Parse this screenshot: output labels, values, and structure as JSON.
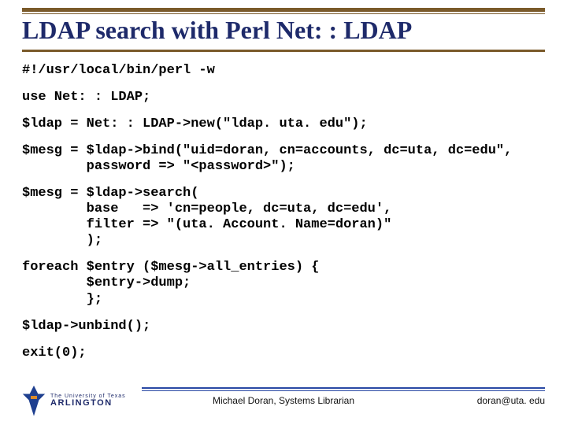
{
  "title": "LDAP search with Perl Net: : LDAP",
  "code": {
    "l1": "#!/usr/local/bin/perl -w",
    "l2": "use Net: : LDAP;",
    "l3": "$ldap = Net: : LDAP->new(\"ldap. uta. edu\");",
    "l4a": "$mesg = $ldap->bind(\"uid=doran, cn=accounts, dc=uta, dc=edu\",",
    "l4b": "        password => \"<password>\");",
    "l5a": "$mesg = $ldap->search(",
    "l5b": "        base   => 'cn=people, dc=uta, dc=edu',",
    "l5c": "        filter => \"(uta. Account. Name=doran)\"",
    "l5d": "        );",
    "l6a": "foreach $entry ($mesg->all_entries) {",
    "l6b": "        $entry->dump;",
    "l6c": "        };",
    "l7": "$ldap->unbind();",
    "l8": "exit(0);"
  },
  "footer": {
    "logo_top": "The University of Texas",
    "logo_main": "ARLINGTON",
    "center": "Michael Doran, Systems Librarian",
    "right": "doran@uta. edu"
  },
  "colors": {
    "title": "#1e2a6a",
    "rule": "#7a5a2a",
    "footer_rule": "#2a49a5"
  }
}
